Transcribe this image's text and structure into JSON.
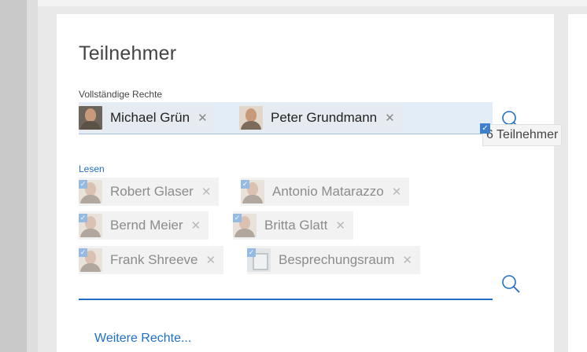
{
  "colors": {
    "accent": "#1f6fc5",
    "panel": "#ffffff",
    "input_bg": "#e3edf8"
  },
  "dialog": {
    "title": "Teilnehmer"
  },
  "full_rights": {
    "label": "Vollständige Rechte",
    "participants": [
      {
        "name": "Michael Grün",
        "remove": "✕",
        "avatar_icon": "person-photo-icon"
      },
      {
        "name": "Peter Grundmann",
        "remove": "✕",
        "avatar_icon": "person-photo-icon"
      }
    ],
    "search_icon": "search-icon"
  },
  "count_tooltip": {
    "text": "6 Teilnehmer",
    "checked": "✓"
  },
  "read_rights": {
    "label": "Lesen",
    "participants": [
      {
        "name": "Robert Glaser",
        "remove": "✕",
        "checked": "✓",
        "avatar_icon": "person-photo-icon"
      },
      {
        "name": "Antonio Matarazzo",
        "remove": "✕",
        "checked": "✓",
        "avatar_icon": "person-photo-icon"
      },
      {
        "name": "Bernd Meier",
        "remove": "✕",
        "checked": "✓",
        "avatar_icon": "person-photo-icon"
      },
      {
        "name": "Britta Glatt",
        "remove": "✕",
        "checked": "✓",
        "avatar_icon": "person-photo-icon"
      },
      {
        "name": "Frank Shreeve",
        "remove": "✕",
        "checked": "✓",
        "avatar_icon": "person-photo-icon"
      },
      {
        "name": "Besprechungsraum",
        "remove": "✕",
        "checked": "✓",
        "avatar_icon": "room-icon"
      }
    ],
    "search_icon": "search-icon"
  },
  "more_rights_link": "Weitere Rechte..."
}
